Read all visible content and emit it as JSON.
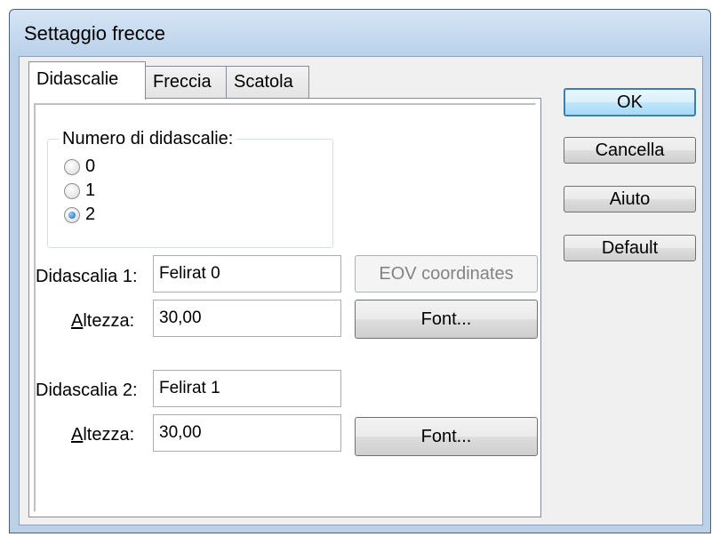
{
  "window": {
    "title": "Settaggio frecce"
  },
  "tabs": [
    {
      "label": "Didascalie",
      "active": true
    },
    {
      "label": "Freccia",
      "active": false
    },
    {
      "label": "Scatola",
      "active": false
    }
  ],
  "captions_group": {
    "legend": "Numero di didascalie:",
    "options": [
      "0",
      "1",
      "2"
    ],
    "selected": "2"
  },
  "caption1": {
    "label": "Didascalia 1:",
    "value": "Felirat 0",
    "height_label_mnemonic": "A",
    "height_label_rest": "ltezza:",
    "height_value": "30,00",
    "eov_button": "EOV coordinates",
    "font_button": "Font..."
  },
  "caption2": {
    "label": "Didascalia 2:",
    "value": "Felirat 1",
    "height_label_mnemonic": "A",
    "height_label_rest": "ltezza:",
    "height_value": "30,00",
    "font_button": "Font..."
  },
  "side_buttons": {
    "ok": "OK",
    "cancel": "Cancella",
    "help": "Aiuto",
    "default": "Default"
  }
}
